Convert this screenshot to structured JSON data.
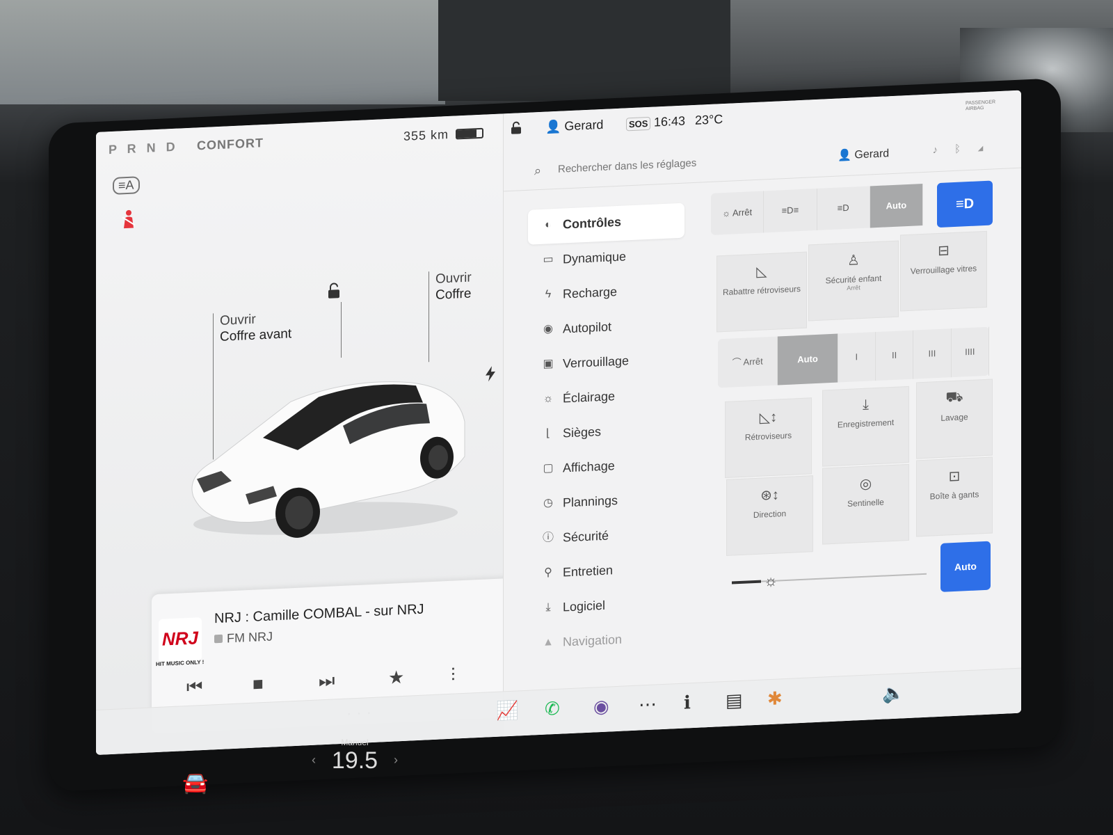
{
  "status": {
    "gear": "P R N D",
    "separator": "·",
    "drive_mode": "CONFORT",
    "range": "355 km",
    "battery_level": 0.78
  },
  "car_panel": {
    "front_trunk": {
      "line1": "Ouvrir",
      "line2": "Coffre avant"
    },
    "trunk": {
      "line1": "Ouvrir",
      "line2": "Coffre"
    },
    "icons": [
      "auto-high-beam-icon",
      "seatbelt-warning-icon",
      "unlock-icon",
      "charge-port-bolt-icon"
    ]
  },
  "media": {
    "logo": "NRJ",
    "logo_tag": "HIT MUSIC ONLY !",
    "title": "NRJ : Camille COMBAL - sur NRJ",
    "station": "FM NRJ",
    "controls": {
      "prev": "⏮",
      "stop": "■",
      "next": "⏭",
      "fav": "★",
      "eq": "⫶",
      "search": "⌕"
    }
  },
  "topbar": {
    "user": "Gerard",
    "sos": "SOS",
    "time": "16:43",
    "temp": "23°C",
    "airbag": "PASSENGER AIRBAG"
  },
  "search": {
    "placeholder": "Rechercher dans les réglages",
    "user": "Gerard"
  },
  "menu": [
    {
      "label": "Contrôles",
      "icon": "◐",
      "active": true
    },
    {
      "label": "Dynamique",
      "icon": "▭"
    },
    {
      "label": "Recharge",
      "icon": "ϟ"
    },
    {
      "label": "Autopilot",
      "icon": "◉"
    },
    {
      "label": "Verrouillage",
      "icon": "▣"
    },
    {
      "label": "Éclairage",
      "icon": "☼"
    },
    {
      "label": "Sièges",
      "icon": "⌊"
    },
    {
      "label": "Affichage",
      "icon": "▢"
    },
    {
      "label": "Plannings",
      "icon": "◷"
    },
    {
      "label": "Sécurité",
      "icon": "ⓘ"
    },
    {
      "label": "Entretien",
      "icon": "⚲"
    },
    {
      "label": "Logiciel",
      "icon": "⤓"
    },
    {
      "label": "Navigation",
      "icon": "▲"
    }
  ],
  "controls": {
    "lights": {
      "off": "Arrêt",
      "auto": "Auto",
      "off_icon": "☼",
      "parking_icon": "≡D≡",
      "low_icon": "≡D"
    },
    "tiles": {
      "fold_mirrors": "Rabattre rétroviseurs",
      "child_lock": "Sécurité enfant",
      "child_lock_state": "Arrêt",
      "window_lock": "Verrouillage vitres",
      "mirrors": "Rétroviseurs",
      "recording": "Enregistrement",
      "wash": "Lavage",
      "steering": "Direction",
      "sentry": "Sentinelle",
      "glovebox": "Boîte à gants"
    },
    "wipers": {
      "off": "Arrêt",
      "auto": "Auto",
      "s1": "I",
      "s2": "II",
      "s3": "III",
      "s4": "IIII"
    },
    "brightness_auto": "Auto",
    "brightness_level": 0.15
  },
  "climate": {
    "mode": "Manuel",
    "temp": "19.5"
  },
  "colors": {
    "accent": "#2e6fe8",
    "nrj_red": "#d0021b"
  }
}
